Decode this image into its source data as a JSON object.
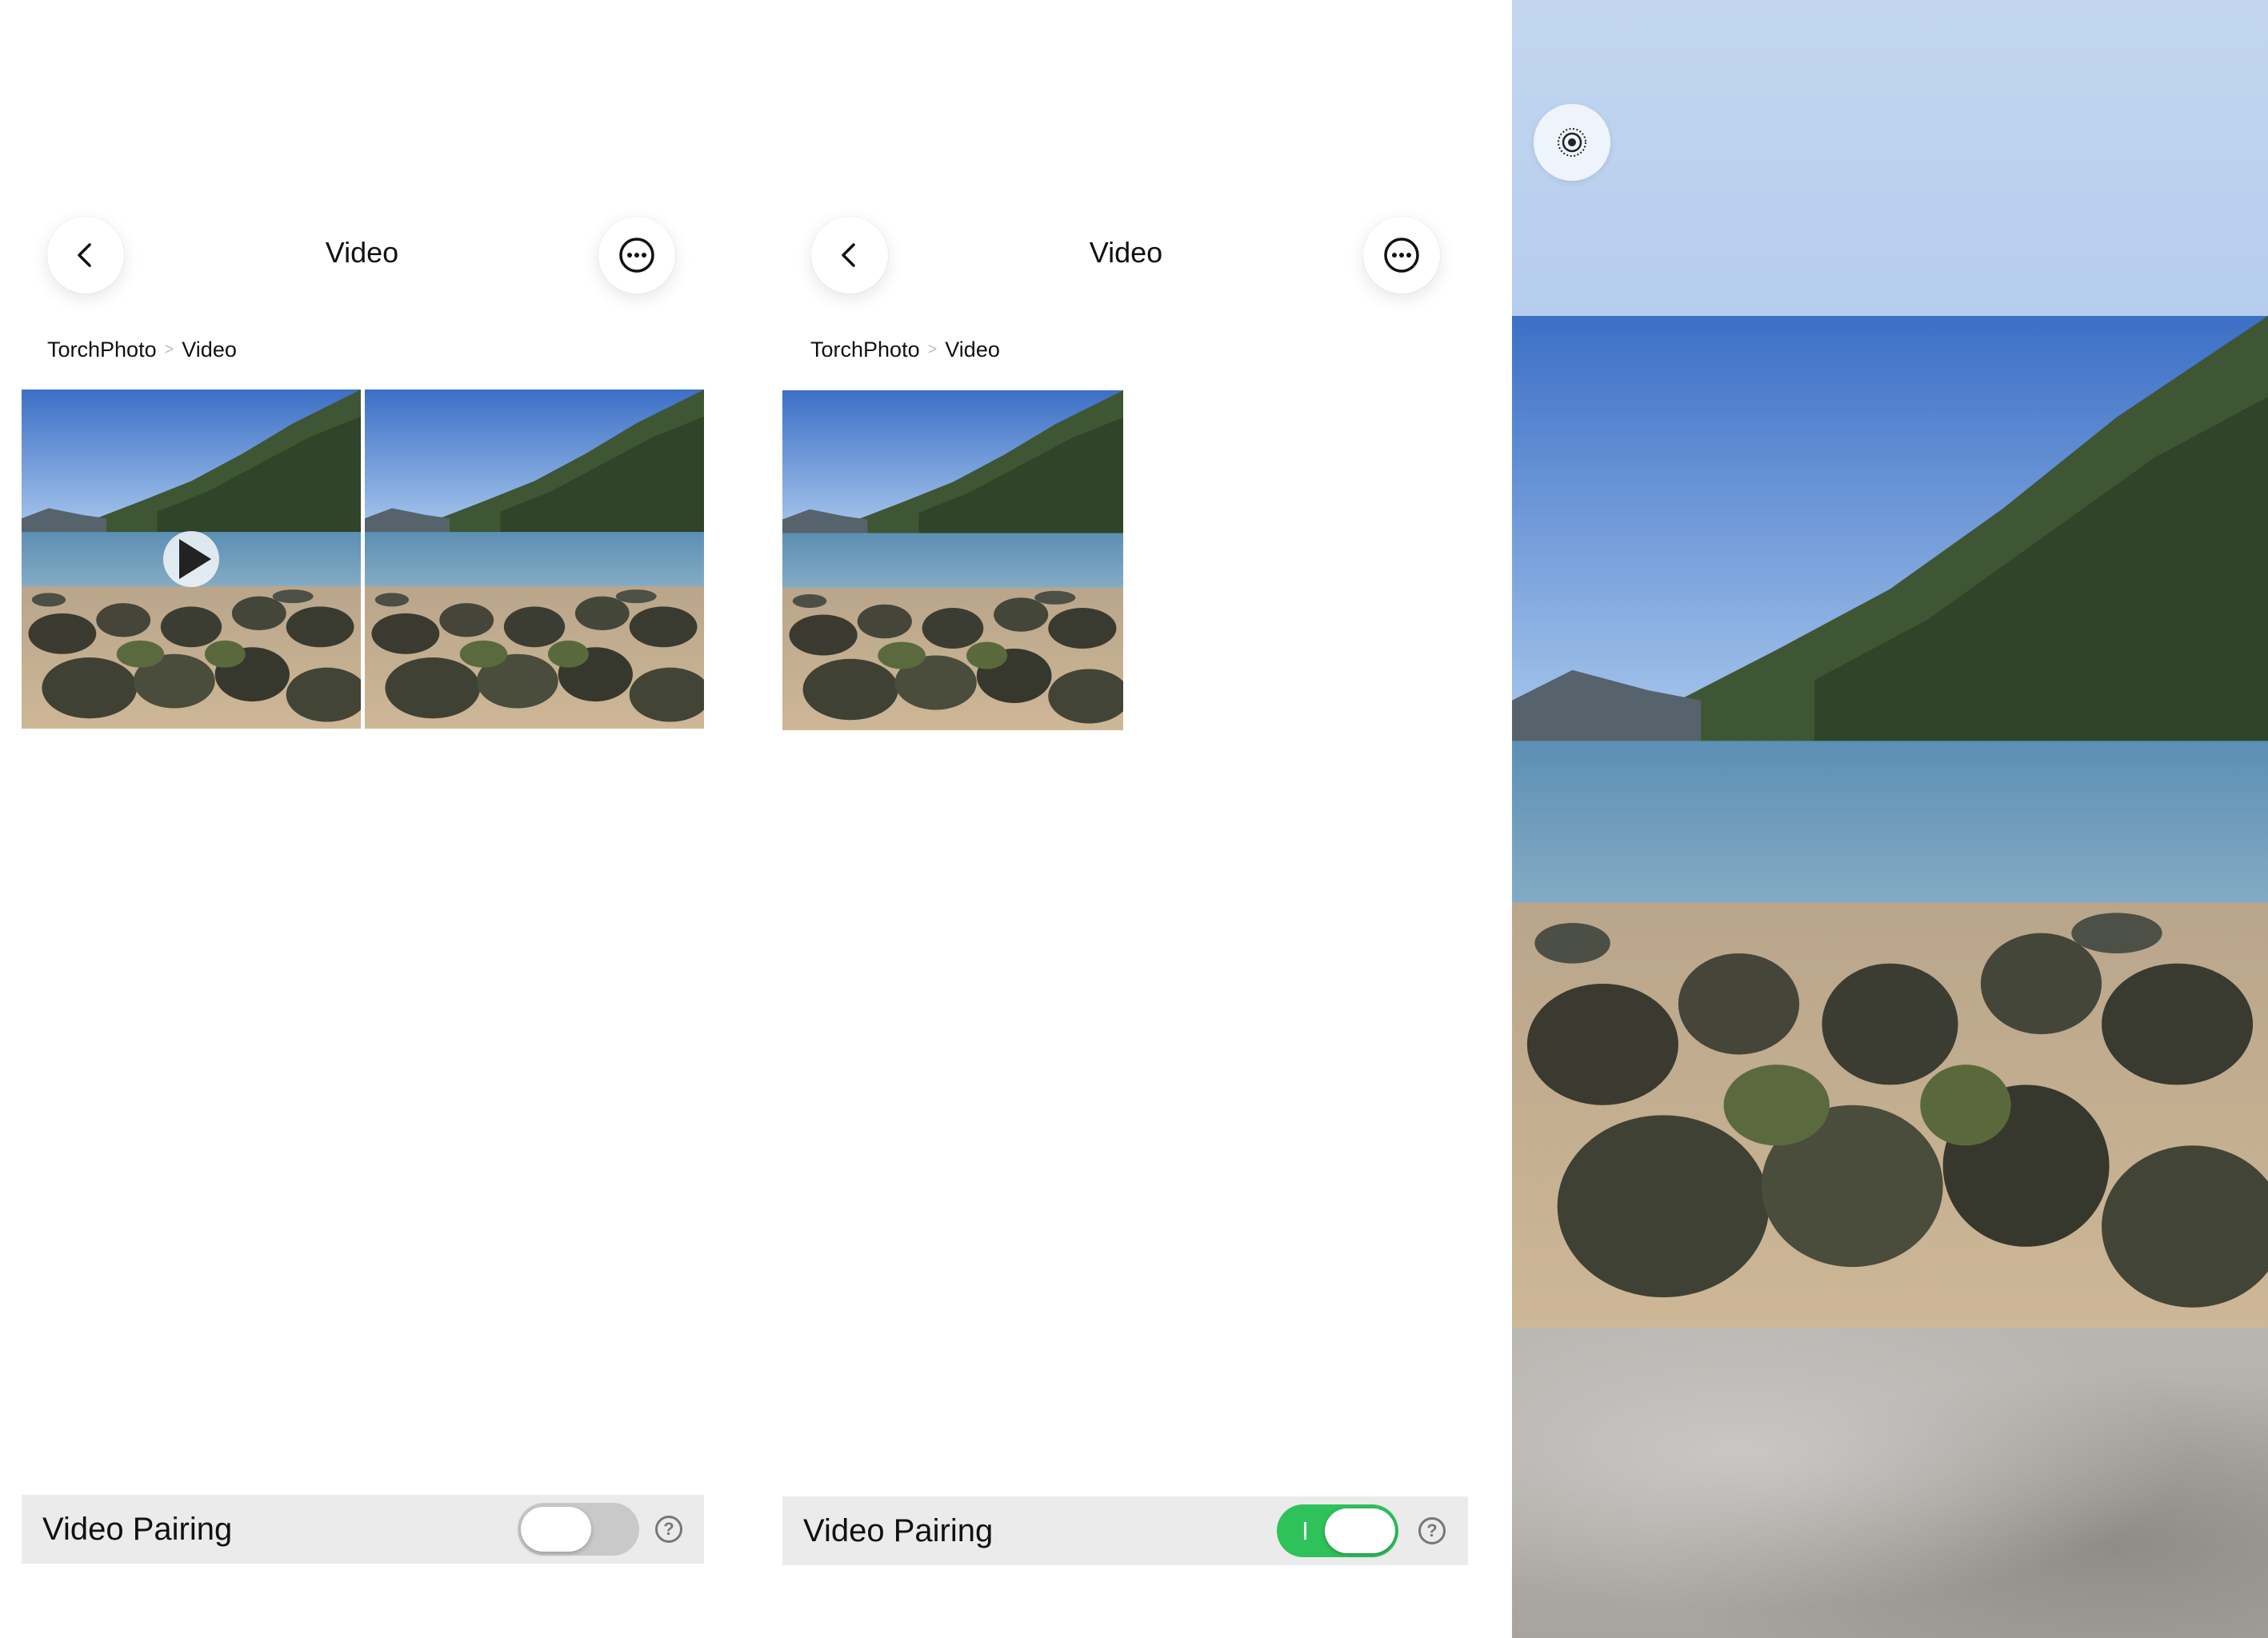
{
  "panels": [
    {
      "header": {
        "title": "Video"
      },
      "breadcrumb": {
        "root": "TorchPhoto",
        "current": "Video"
      },
      "pairing": {
        "label": "Video Pairing",
        "enabled": false
      }
    },
    {
      "header": {
        "title": "Video"
      },
      "breadcrumb": {
        "root": "TorchPhoto",
        "current": "Video"
      },
      "pairing": {
        "label": "Video Pairing",
        "enabled": true
      }
    }
  ],
  "icons": {
    "back": "chevron-left-icon",
    "more": "more-horizontal-circle-icon",
    "play": "play-icon",
    "help": "help-circle-icon",
    "live": "live-photo-icon"
  },
  "colors": {
    "toggle_on": "#2fc25b",
    "toggle_off": "#c9c9c9",
    "pairing_bar": "#ebebeb"
  },
  "help_glyph": "?"
}
